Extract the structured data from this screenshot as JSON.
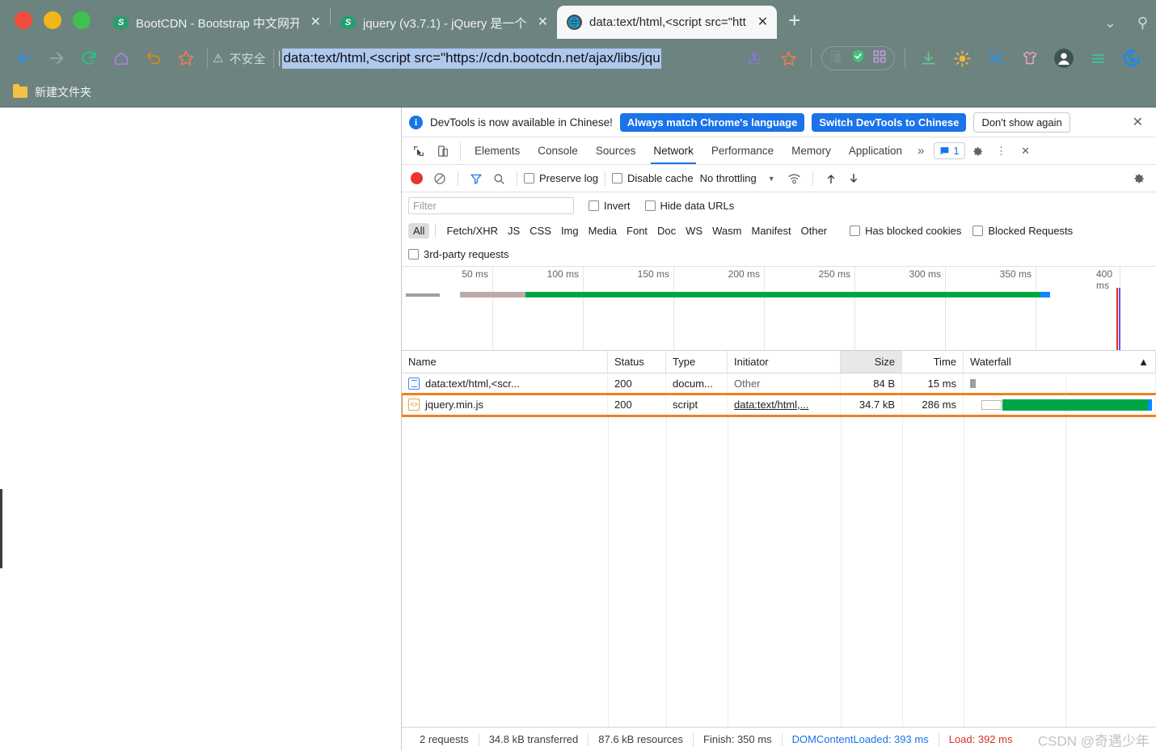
{
  "browser": {
    "tabs": [
      {
        "title": "BootCDN - Bootstrap 中文网开",
        "favicon": "bootcdn-icon",
        "active": false,
        "close": "✕"
      },
      {
        "title": "jquery (v3.7.1) - jQuery 是一个",
        "favicon": "bootcdn-icon",
        "active": false,
        "close": "✕"
      },
      {
        "title": "data:text/html,<script src=\"htt",
        "favicon": "globe-icon",
        "active": true,
        "close": "✕"
      }
    ],
    "new_tab_label": "+",
    "tab_search_icon": "chevron-down-icon",
    "pin_icon": "pin-icon",
    "toolbar": {
      "back": "←",
      "forward": "→",
      "reload": "⟳",
      "home": "⌂",
      "undo": "↺",
      "bookmark_star": "☆",
      "security_warning_icon": "⚠",
      "security_label": "不安全",
      "url": "data:text/html,<script src=\"https://cdn.bootcdn.net/ajax/libs/jqu",
      "share": "share-icon",
      "star2": "star-icon",
      "ext_copy": "copy-icon",
      "ext_shield": "shield-check-icon",
      "ext_grid": "grid-icon",
      "download": "download-icon",
      "sun": "sun-icon",
      "capture": "screenshot-icon",
      "theme": "shirt-icon",
      "profile": "avatar-icon",
      "menu": "hamburger-icon",
      "logo": "browser-logo-icon"
    },
    "bookmarks": [
      {
        "label": "新建文件夹",
        "icon": "folder-icon"
      }
    ]
  },
  "devtools": {
    "banner": {
      "info_icon": "i",
      "message": "DevTools is now available in Chinese!",
      "primary_button": "Always match Chrome's language",
      "secondary_button": "Switch DevTools to Chinese",
      "tertiary_button": "Don't show again",
      "close": "✕"
    },
    "panel_tabs": [
      {
        "label": "Elements",
        "active": false
      },
      {
        "label": "Console",
        "active": false
      },
      {
        "label": "Sources",
        "active": false
      },
      {
        "label": "Network",
        "active": true
      },
      {
        "label": "Performance",
        "active": false
      },
      {
        "label": "Memory",
        "active": false
      },
      {
        "label": "Application",
        "active": false
      }
    ],
    "more_tabs": "»",
    "message_count": "1",
    "settings_icon": "gear-icon",
    "kebab_icon": "more-vertical-icon",
    "close_icon": "✕",
    "inspect_icon": "inspect-icon",
    "device_icon": "device-toggle-icon",
    "network_toolbar": {
      "record": "record-icon",
      "clear": "clear-icon",
      "filter": "filter-icon",
      "search": "search-icon",
      "preserve_log": "Preserve log",
      "disable_cache": "Disable cache",
      "throttling": "No throttling",
      "throttle_caret": "▼",
      "wifi": "network-conditions-icon",
      "import": "import-har-icon",
      "export": "export-har-icon",
      "settings": "gear-icon"
    },
    "filter_bar": {
      "placeholder": "Filter",
      "value": "",
      "invert": "Invert",
      "hide_data_urls": "Hide data URLs"
    },
    "type_filters": [
      {
        "label": "All",
        "selected": true
      },
      {
        "label": "Fetch/XHR",
        "selected": false
      },
      {
        "label": "JS",
        "selected": false
      },
      {
        "label": "CSS",
        "selected": false
      },
      {
        "label": "Img",
        "selected": false
      },
      {
        "label": "Media",
        "selected": false
      },
      {
        "label": "Font",
        "selected": false
      },
      {
        "label": "Doc",
        "selected": false
      },
      {
        "label": "WS",
        "selected": false
      },
      {
        "label": "Wasm",
        "selected": false
      },
      {
        "label": "Manifest",
        "selected": false
      },
      {
        "label": "Other",
        "selected": false
      }
    ],
    "extra_filters": {
      "has_blocked_cookies": "Has blocked cookies",
      "blocked_requests": "Blocked Requests",
      "third_party": "3rd-party requests"
    },
    "overview": {
      "ticks": [
        "50 ms",
        "100 ms",
        "150 ms",
        "200 ms",
        "250 ms",
        "300 ms",
        "350 ms",
        "400 ms"
      ],
      "dcl_marker_color": "#0f87ff",
      "load_marker_color": "#d93025"
    },
    "table": {
      "columns": [
        "Name",
        "Status",
        "Type",
        "Initiator",
        "Size",
        "Time",
        "Waterfall"
      ],
      "sort_indicator": "▲",
      "rows": [
        {
          "icon": "document-icon",
          "name": "data:text/html,<scr...",
          "status": "200",
          "type": "docum...",
          "initiator": "Other",
          "size": "84 B",
          "time": "15 ms",
          "highlighted": false
        },
        {
          "icon": "script-icon",
          "name": "jquery.min.js",
          "status": "200",
          "type": "script",
          "initiator": "data:text/html,...",
          "size": "34.7 kB",
          "time": "286 ms",
          "highlighted": true
        }
      ]
    },
    "status_bar": {
      "requests": "2 requests",
      "transferred": "34.8 kB transferred",
      "resources": "87.6 kB resources",
      "finish": "Finish: 350 ms",
      "dom_content_loaded": "DOMContentLoaded: 393 ms",
      "load": "Load: 392 ms"
    }
  },
  "watermark": "CSDN @奇遇少年"
}
